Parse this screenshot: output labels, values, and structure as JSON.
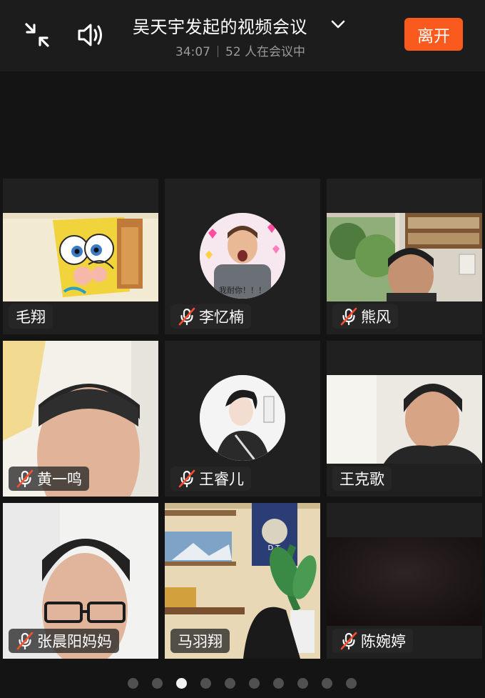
{
  "header": {
    "title": "吴天宇发起的视频会议",
    "elapsed": "34:07",
    "participants": "52 人在会议中",
    "leave_label": "离开"
  },
  "tiles": [
    {
      "name": "毛翔",
      "muted": false
    },
    {
      "name": "李忆楠",
      "muted": true
    },
    {
      "name": "熊风",
      "muted": true
    },
    {
      "name": "黄一鸣",
      "muted": true
    },
    {
      "name": "王睿儿",
      "muted": true
    },
    {
      "name": "王克歌",
      "muted": false
    },
    {
      "name": "张晨阳妈妈",
      "muted": true
    },
    {
      "name": "马羽翔",
      "muted": false
    },
    {
      "name": "陈婉婷",
      "muted": true
    }
  ],
  "avatar_caption": "我耐你！！！",
  "poster_text": "D.T.",
  "pagination": {
    "total": 10,
    "current": 3
  },
  "colors": {
    "accent": "#fa5a1e",
    "background": "#141414",
    "tile": "#202020",
    "muted_slash": "#ff4d2e"
  }
}
